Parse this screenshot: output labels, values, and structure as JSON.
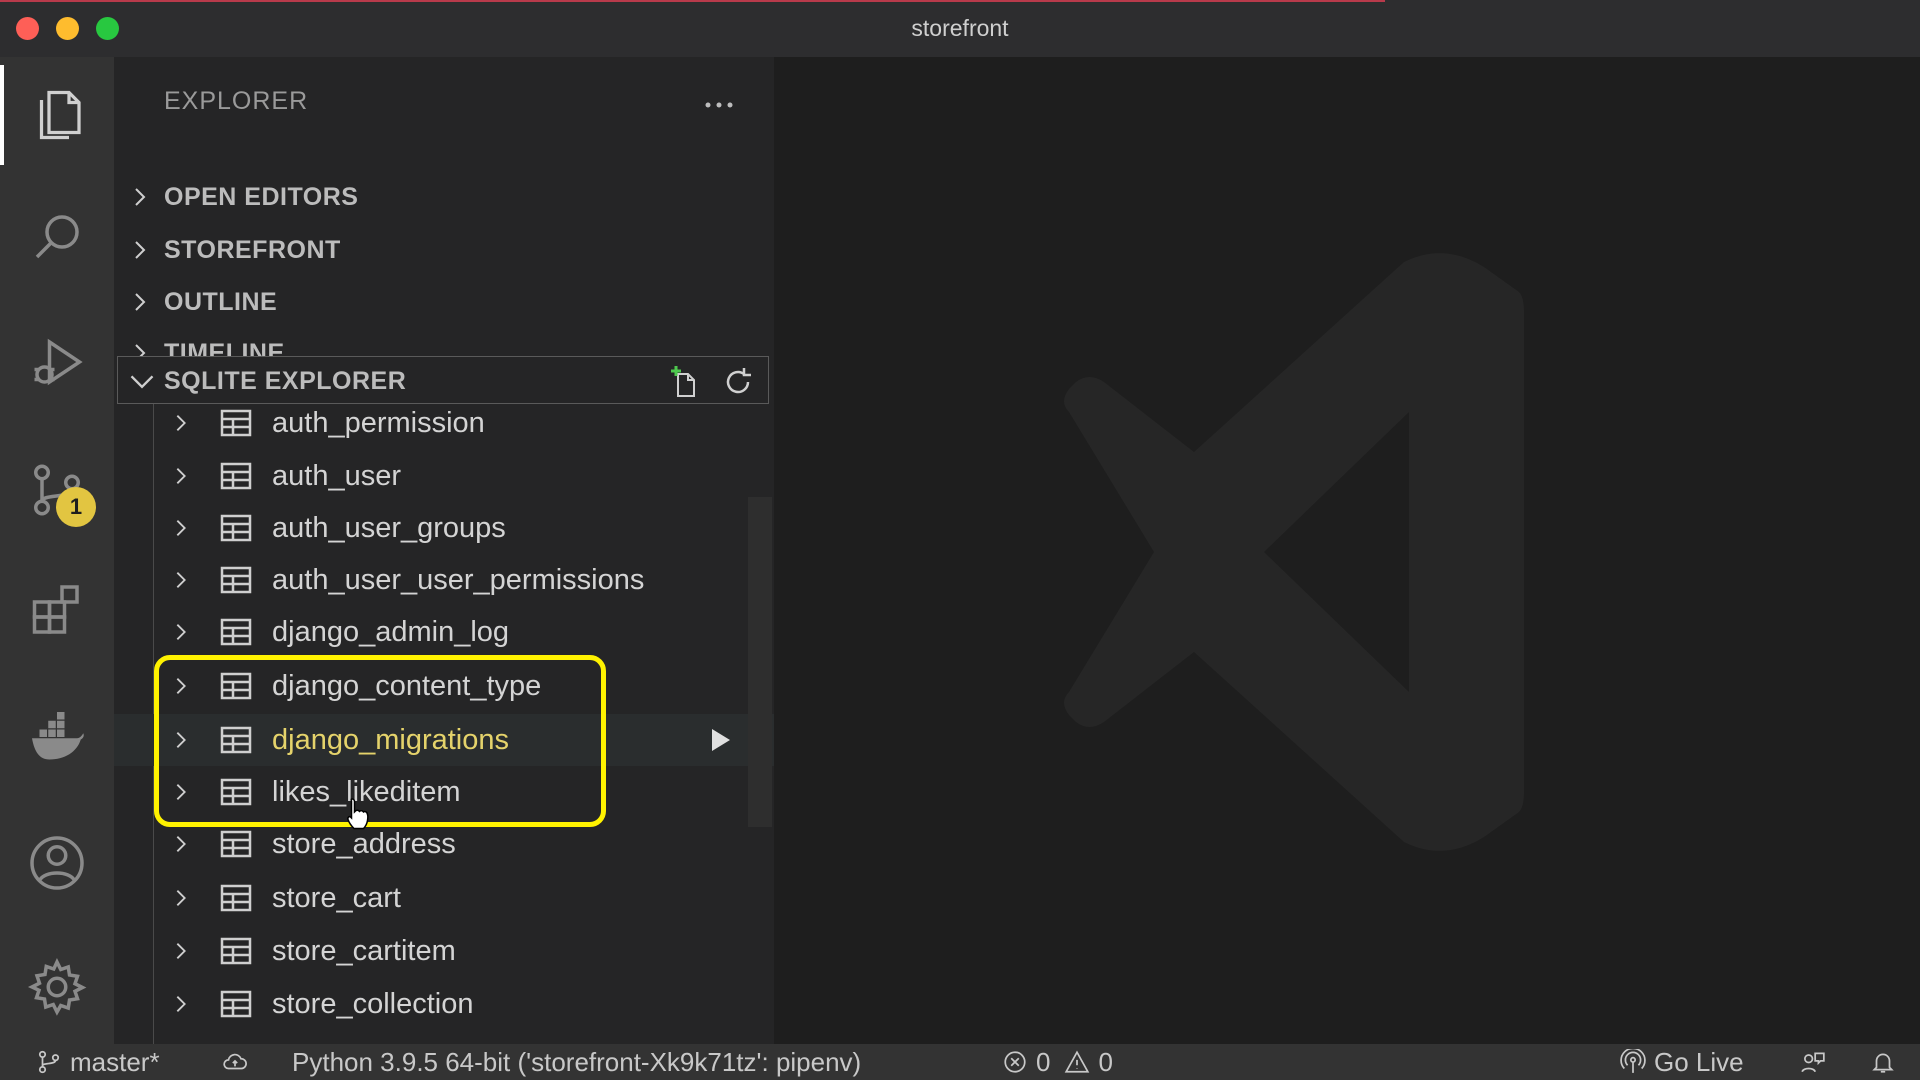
{
  "window": {
    "title": "storefront"
  },
  "activity_bar": {
    "items": [
      "files-icon",
      "search-icon",
      "run-debug-icon",
      "source-control-icon",
      "extensions-icon",
      "docker-icon",
      "accounts-icon",
      "settings-icon"
    ],
    "scm_badge": "1"
  },
  "sidebar": {
    "title": "EXPLORER",
    "sections": [
      {
        "label": "OPEN EDITORS"
      },
      {
        "label": "STOREFRONT"
      },
      {
        "label": "OUTLINE"
      },
      {
        "label": "TIMELINE"
      }
    ],
    "sqlite": {
      "label": "SQLITE EXPLORER",
      "tables": [
        {
          "name": "auth_permission"
        },
        {
          "name": "auth_user"
        },
        {
          "name": "auth_user_groups"
        },
        {
          "name": "auth_user_user_permissions"
        },
        {
          "name": "django_admin_log"
        },
        {
          "name": "django_content_type"
        },
        {
          "name": "django_migrations"
        },
        {
          "name": "likes_likeditem"
        },
        {
          "name": "store_address"
        },
        {
          "name": "store_cart"
        },
        {
          "name": "store_cartitem"
        },
        {
          "name": "store_collection"
        }
      ]
    }
  },
  "statusbar": {
    "branch": "master*",
    "interpreter": "Python 3.9.5 64-bit ('storefront-Xk9k71tz': pipenv)",
    "errors": "0",
    "warnings": "0",
    "go_live": "Go Live"
  },
  "colors": {
    "highlight": "#fff200",
    "hover_text": "#e5d36b",
    "badge": "#e2c541"
  }
}
